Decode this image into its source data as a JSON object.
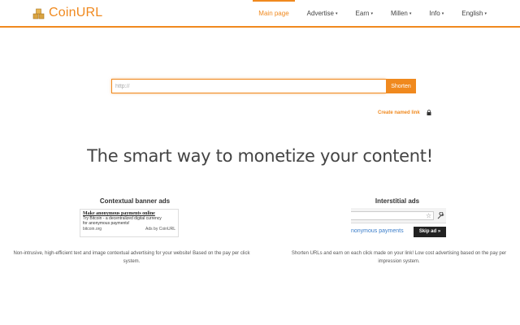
{
  "header": {
    "logo_text": "CoinURL",
    "nav": [
      {
        "label": "Main page",
        "caret": ""
      },
      {
        "label": "Advertise",
        "caret": "▾"
      },
      {
        "label": "Earn",
        "caret": "▾"
      },
      {
        "label": "Millen",
        "caret": "▾"
      },
      {
        "label": "Info",
        "caret": "▾"
      },
      {
        "label": "English",
        "caret": "▾"
      }
    ]
  },
  "shorten": {
    "placeholder": "http://",
    "button_label": "Shorten",
    "named_link": "Create named link"
  },
  "hero": {
    "headline": "The smart way to monetize your content!"
  },
  "features": {
    "banner": {
      "title": "Contextual banner ads",
      "ad": {
        "headline": "Make anonymous payments online",
        "line1": "Try Bitcoin - a decentralized digital currency",
        "line2": "for anonymous payments!",
        "domain": "bitcoin.org",
        "by": "Ads by CoinURL"
      },
      "description": "Non-intrusive, high-efficient text and image contextual advertising for your website! Based on the pay per click system."
    },
    "interstitial": {
      "title": "Interstitial ads",
      "preview_text": "nonymous payments",
      "skip_label": "Skip ad »",
      "description": "Shorten URLs and earn on each click made on your link! Low cost advertising based on the pay per impression system."
    }
  },
  "colors": {
    "accent": "#f0891e",
    "link_blue": "#3a7dc9"
  }
}
